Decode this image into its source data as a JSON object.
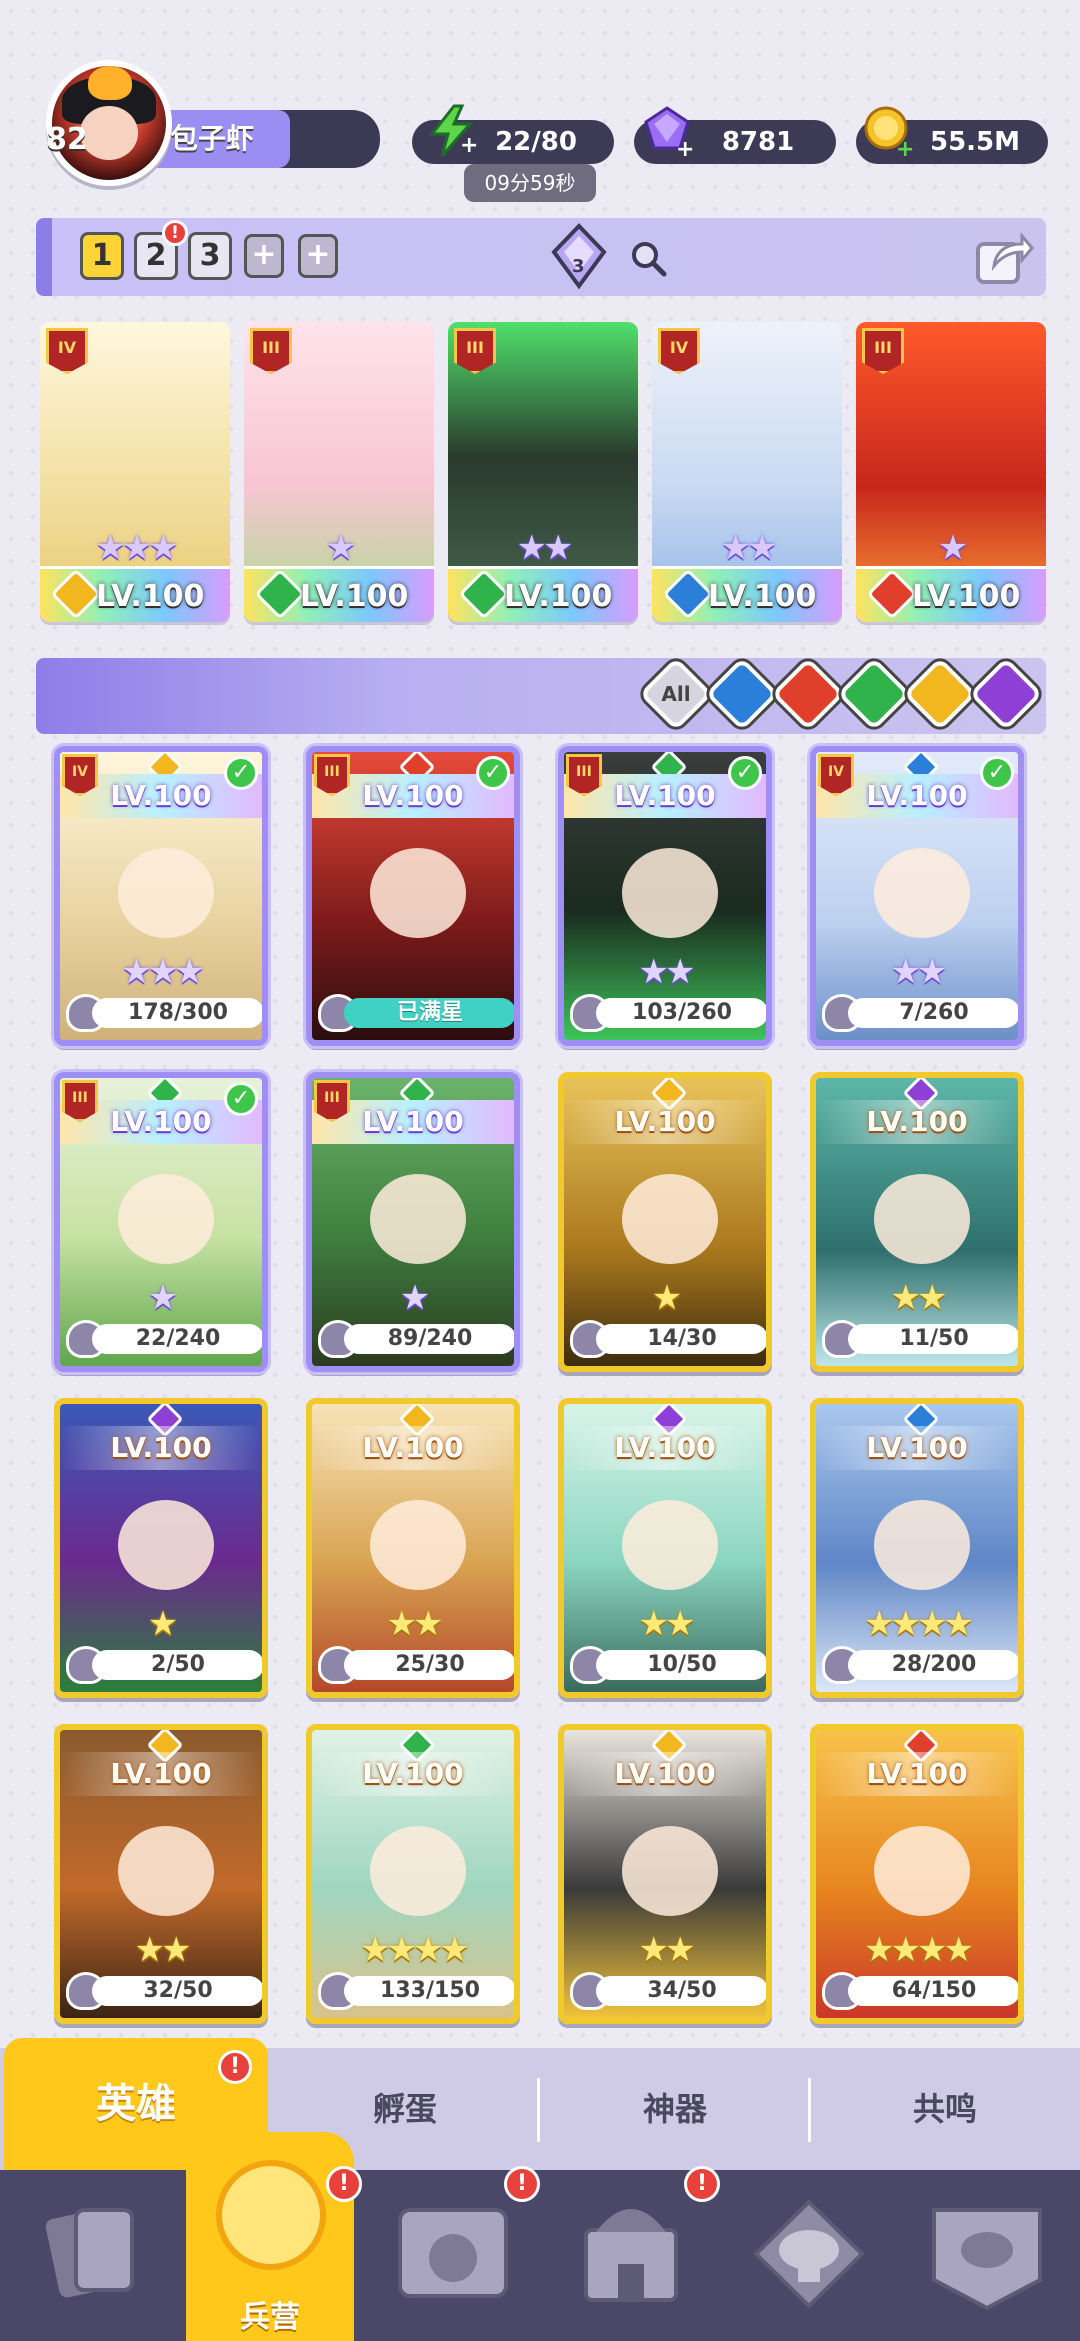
{
  "player": {
    "level": "82",
    "name": "包子虾"
  },
  "resources": {
    "energy": "22/80",
    "energy_timer": "09分59秒",
    "gems": "8781",
    "gold": "55.5M"
  },
  "team_tabs": {
    "tabs": [
      "1",
      "2",
      "3"
    ],
    "plus": [
      "+",
      "+"
    ],
    "alert": "!",
    "gem_count": "3"
  },
  "team": [
    {
      "rank": "IV",
      "level": "LV.100",
      "stars": "★★★",
      "element_color": "#f2b61f"
    },
    {
      "rank": "III",
      "level": "LV.100",
      "stars": "★",
      "element_color": "#2fb34a"
    },
    {
      "rank": "III",
      "level": "LV.100",
      "stars": "★★",
      "element_color": "#2fb34a"
    },
    {
      "rank": "IV",
      "level": "LV.100",
      "stars": "★★",
      "element_color": "#2b7fd8"
    },
    {
      "rank": "III",
      "level": "LV.100",
      "stars": "★",
      "element_color": "#e0402b"
    }
  ],
  "filters": {
    "all_label": "All",
    "colors": [
      "#2b7fd8",
      "#e0402b",
      "#2fb34a",
      "#f2b61f",
      "#8e3fd6"
    ]
  },
  "heroes": [
    {
      "rank": "IV",
      "level": "LV.100",
      "progress": "178/300",
      "stars": "★★★",
      "frame": "pur",
      "checked": "✓",
      "el": "#f2b61f",
      "bg": "linear-gradient(180deg,#fff6dc,#e8d29f 60%,#cfb27a)"
    },
    {
      "rank": "III",
      "level": "LV.100",
      "progress": "已满星",
      "stars": "",
      "frame": "pur",
      "checked": "✓",
      "el": "#e0402b",
      "bg": "linear-gradient(180deg,#e84a3a,#7c1a1a 60%,#2b0d0d)"
    },
    {
      "rank": "III",
      "level": "LV.100",
      "progress": "103/260",
      "stars": "★★",
      "frame": "pur",
      "checked": "✓",
      "el": "#2fb34a",
      "bg": "linear-gradient(180deg,#3a3d3d,#1a2b1f 55%,#3ec45a)"
    },
    {
      "rank": "IV",
      "level": "LV.100",
      "progress": "7/260",
      "stars": "★★",
      "frame": "pur",
      "checked": "✓",
      "el": "#2b7fd8",
      "bg": "linear-gradient(180deg,#e3ebfa,#bcd0ef 60%,#6c8fc9)"
    },
    {
      "rank": "III",
      "level": "LV.100",
      "progress": "22/240",
      "stars": "★",
      "frame": "pur",
      "checked": "✓",
      "el": "#2fb34a",
      "bg": "linear-gradient(180deg,#e7f2d8,#c7e2a3 55%,#5fa64c)"
    },
    {
      "rank": "III",
      "level": "LV.100",
      "progress": "89/240",
      "stars": "★",
      "frame": "pur",
      "checked": "",
      "el": "#2fb34a",
      "bg": "linear-gradient(180deg,#6bb36b,#3e7f3e 55%,#2b3a20)"
    },
    {
      "rank": "",
      "level": "LV.100",
      "progress": "14/30",
      "stars": "★",
      "frame": "gold",
      "checked": "",
      "el": "#f2b61f",
      "bg": "linear-gradient(180deg,#e9c35a,#a9781d 60%,#3e2c10)"
    },
    {
      "rank": "",
      "level": "LV.100",
      "progress": "11/50",
      "stars": "★★",
      "frame": "gold",
      "checked": "",
      "el": "#8e3fd6",
      "bg": "linear-gradient(180deg,#5cb7a8,#2e6f6c 60%,#bfe7ea)"
    },
    {
      "rank": "",
      "level": "LV.100",
      "progress": "2/50",
      "stars": "★",
      "frame": "gold",
      "checked": "",
      "el": "#8e3fd6",
      "bg": "linear-gradient(180deg,#3b58b6,#6b2a8f 55%,#2b7f3a)"
    },
    {
      "rank": "",
      "level": "LV.100",
      "progress": "25/30",
      "stars": "★★",
      "frame": "gold",
      "checked": "",
      "el": "#f2b61f",
      "bg": "linear-gradient(180deg,#f7e3b7,#d9a452 55%,#b4482a)"
    },
    {
      "rank": "",
      "level": "LV.100",
      "progress": "10/50",
      "stars": "★★",
      "frame": "gold",
      "checked": "",
      "el": "#8e3fd6",
      "bg": "linear-gradient(180deg,#d8f3e8,#8ad6c0 55%,#3a6b5d)"
    },
    {
      "rank": "",
      "level": "LV.100",
      "progress": "28/200",
      "stars": "★★★★",
      "frame": "gold",
      "checked": "",
      "el": "#2b7fd8",
      "bg": "linear-gradient(180deg,#a9c7ee,#5f86c6 55%,#dde8f7)"
    },
    {
      "rank": "",
      "level": "LV.100",
      "progress": "32/50",
      "stars": "★★",
      "frame": "gold",
      "checked": "",
      "el": "#f2b61f",
      "bg": "linear-gradient(180deg,#8a5a2e,#c26a2a 55%,#3b2415)"
    },
    {
      "rank": "",
      "level": "LV.100",
      "progress": "133/150",
      "stars": "★★★★",
      "frame": "gold",
      "checked": "",
      "el": "#2fb34a",
      "bg": "linear-gradient(180deg,#e0f1e6,#9fd6c0 55%,#d9c28a)"
    },
    {
      "rank": "",
      "level": "LV.100",
      "progress": "34/50",
      "stars": "★★",
      "frame": "gold",
      "checked": "",
      "el": "#f2b61f",
      "bg": "linear-gradient(180deg,#e9e4dc,#3a3a3a 55%,#f1c33b)"
    },
    {
      "rank": "",
      "level": "LV.100",
      "progress": "64/150",
      "stars": "★★★★",
      "frame": "gold",
      "checked": "",
      "el": "#e0402b",
      "bg": "linear-gradient(180deg,#f8c24a,#e7861f 55%,#c9372a)"
    }
  ],
  "sub_tabs": [
    "英雄",
    "孵蛋",
    "神器",
    "共鸣"
  ],
  "nav": {
    "active_label": "兵营",
    "alerts": [
      "!",
      "!",
      "!",
      "!"
    ]
  }
}
